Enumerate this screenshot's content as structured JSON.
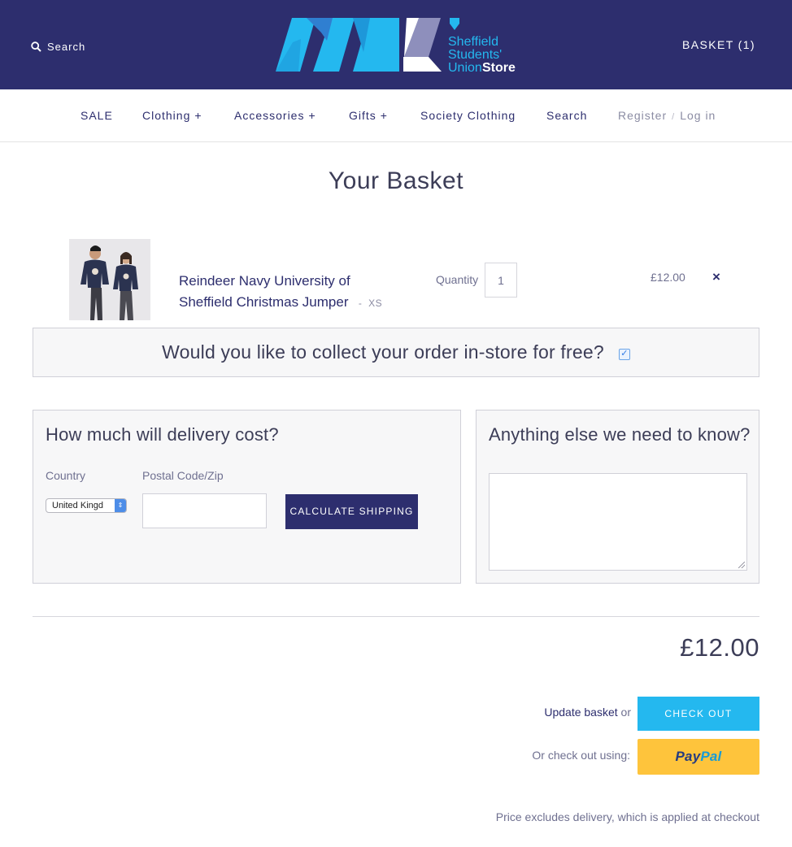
{
  "header": {
    "search_label": "Search",
    "basket_label": "BASKET (1)",
    "logo": {
      "line1": "Sheffield",
      "line2": "Students'",
      "line3_a": "Union",
      "line3_b": "Store"
    }
  },
  "nav": {
    "items": [
      {
        "label": "SALE",
        "plus": ""
      },
      {
        "label": "Clothing",
        "plus": "+"
      },
      {
        "label": "Accessories",
        "plus": "+"
      },
      {
        "label": "Gifts",
        "plus": "+"
      },
      {
        "label": "Society Clothing",
        "plus": ""
      },
      {
        "label": "Search",
        "plus": ""
      }
    ],
    "register": "Register",
    "separator": "/",
    "login": "Log in"
  },
  "page": {
    "title": "Your Basket"
  },
  "cart": {
    "item": {
      "name": "Reindeer Navy University of Sheffield Christmas Jumper",
      "variant_sep": "-",
      "variant": "XS",
      "quantity_label": "Quantity",
      "quantity": "1",
      "price": "£12.00",
      "remove_icon": "×"
    }
  },
  "collect": {
    "question": "Would you like to collect your order in-store for free?",
    "checked": true
  },
  "shipping": {
    "title": "How much will delivery cost?",
    "country_label": "Country",
    "country_value": "United Kingd",
    "zip_label": "Postal Code/Zip",
    "zip_value": "",
    "button_label": "CALCULATE SHIPPING"
  },
  "notes": {
    "title": "Anything else we need to know?",
    "value": ""
  },
  "summary": {
    "total": "£12.00",
    "update_label": "Update basket",
    "or": "or",
    "checkout_label": "CHECK OUT",
    "alt_label": "Or check out using:",
    "paypal_a": "Pay",
    "paypal_b": "Pal",
    "note": "Price excludes delivery, which is applied at checkout"
  },
  "colors": {
    "header_bg": "#2d2e6e",
    "accent_blue": "#24b8ef",
    "paypal_yellow": "#fec43c"
  }
}
